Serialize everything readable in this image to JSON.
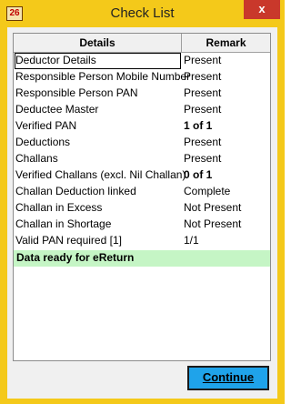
{
  "window": {
    "title": "Check List",
    "app_icon_text": "26",
    "close_glyph": "x"
  },
  "grid": {
    "columns": [
      "Details",
      "Remark"
    ],
    "rows": [
      {
        "detail": "Deductor Details",
        "remark": "Present",
        "bold": false
      },
      {
        "detail": "Responsible Person Mobile Number",
        "remark": "Present",
        "bold": false
      },
      {
        "detail": "Responsible Person PAN",
        "remark": "Present",
        "bold": false
      },
      {
        "detail": "Deductee Master",
        "remark": "Present",
        "bold": false
      },
      {
        "detail": "Verified PAN",
        "remark": "1 of 1",
        "bold": true
      },
      {
        "detail": "Deductions",
        "remark": "Present",
        "bold": false
      },
      {
        "detail": "Challans",
        "remark": "Present",
        "bold": false
      },
      {
        "detail": "Verified Challans (excl. Nil Challan)",
        "remark": "0 of 1",
        "bold": true
      },
      {
        "detail": "Challan Deduction linked",
        "remark": "Complete",
        "bold": false
      },
      {
        "detail": "Challan in Excess",
        "remark": "Not Present",
        "bold": false
      },
      {
        "detail": "Challan in Shortage",
        "remark": "Not Present",
        "bold": false
      },
      {
        "detail": "Valid PAN required [1]",
        "remark": "1/1",
        "bold": false
      }
    ],
    "status_message": "Data ready for eReturn"
  },
  "buttons": {
    "continue_label": "Continue"
  },
  "colors": {
    "frame": "#f4c91a",
    "status_bg": "#c5f5c5",
    "button_bg": "#1fa3ea",
    "close_bg": "#c9382b"
  }
}
